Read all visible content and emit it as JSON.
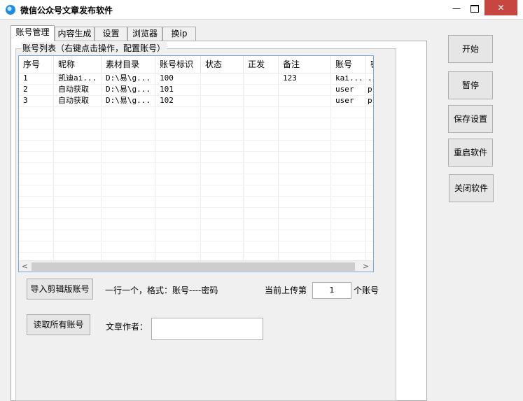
{
  "window": {
    "title": "微信公众号文章发布软件",
    "minimize": "—",
    "close": "✕"
  },
  "tabs": [
    "账号管理",
    "内容生成",
    "设置",
    "浏览器",
    "换ip"
  ],
  "group": {
    "label": "账号列表（右键点击操作，配置账号）"
  },
  "list": {
    "columns": [
      "序号",
      "昵称",
      "素材目录",
      "账号标识",
      "状态",
      "正发",
      "备注",
      "账号",
      "密"
    ],
    "rows": [
      [
        "1",
        "凯迪ai...",
        "D:\\易\\g...",
        "100",
        "",
        "",
        "123",
        "kai...",
        ".."
      ],
      [
        "2",
        "自动获取",
        "D:\\易\\g...",
        "101",
        "",
        "",
        "",
        "user",
        "p"
      ],
      [
        "3",
        "自动获取",
        "D:\\易\\g...",
        "102",
        "",
        "",
        "",
        "user",
        "p"
      ]
    ],
    "scroll_left": "<",
    "scroll_right": ">"
  },
  "actions": {
    "import_label": "导入剪辑版账号",
    "format_hint": "一行一个，格式：账号----密码",
    "upload_prefix": "当前上传第",
    "upload_value": "1",
    "upload_suffix": "个账号",
    "read_all_label": "读取所有账号",
    "author_label": "文章作者：",
    "author_value": ""
  },
  "side_buttons": {
    "start": "开始",
    "pause": "暂停",
    "save": "保存设置",
    "restart": "重启软件",
    "close_app": "关闭软件"
  },
  "colors": {
    "close_btn": "#c7463f",
    "list_border": "#7aa7d6"
  }
}
